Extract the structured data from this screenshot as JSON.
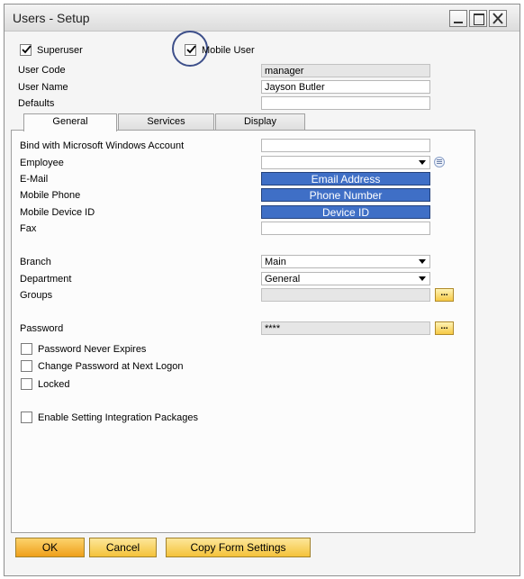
{
  "window": {
    "title": "Users - Setup"
  },
  "top": {
    "superuser": {
      "label": "Superuser",
      "checked": true
    },
    "mobile_user": {
      "label": "Mobile User",
      "checked": true
    },
    "user_code": {
      "label": "User Code",
      "value": "manager"
    },
    "user_name": {
      "label": "User Name",
      "value": "Jayson Butler"
    },
    "defaults": {
      "label": "Defaults",
      "value": ""
    }
  },
  "tabs": [
    {
      "label": "General",
      "active": true
    },
    {
      "label": "Services",
      "active": false
    },
    {
      "label": "Display",
      "active": false
    }
  ],
  "general": {
    "bind_windows": {
      "label": "Bind with Microsoft Windows Account",
      "value": ""
    },
    "employee": {
      "label": "Employee",
      "value": ""
    },
    "email": {
      "label": "E-Mail",
      "value": "Email Address"
    },
    "mobile_phone": {
      "label": "Mobile Phone",
      "value": "Phone Number"
    },
    "mobile_device": {
      "label": "Mobile Device ID",
      "value": "Device ID"
    },
    "fax": {
      "label": "Fax",
      "value": ""
    },
    "branch": {
      "label": "Branch",
      "value": "Main"
    },
    "department": {
      "label": "Department",
      "value": "General"
    },
    "groups": {
      "label": "Groups",
      "value": "",
      "button": "..."
    },
    "password": {
      "label": "Password",
      "value": "****",
      "button": "..."
    },
    "password_never_expires": {
      "label": "Password Never Expires",
      "checked": false
    },
    "change_password": {
      "label": "Change Password at Next Logon",
      "checked": false
    },
    "locked": {
      "label": "Locked",
      "checked": false
    },
    "enable_integration": {
      "label": "Enable Setting Integration Packages",
      "checked": false
    }
  },
  "buttons": {
    "ok": "OK",
    "cancel": "Cancel",
    "copy_form": "Copy Form Settings"
  },
  "colors": {
    "highlight_field": "#3f6fc6",
    "button_accent": "#f4c23a"
  }
}
